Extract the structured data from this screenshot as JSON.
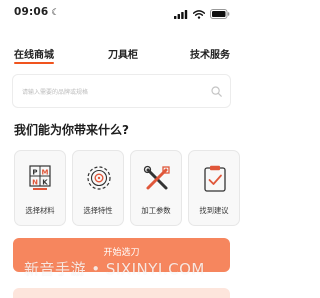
{
  "status_bar": {
    "time": "09:06"
  },
  "tabs": [
    {
      "label": "在线商城",
      "active": true
    },
    {
      "label": "刀具柜",
      "active": false
    },
    {
      "label": "技术服务",
      "active": false
    }
  ],
  "search": {
    "placeholder": "请输入需要的品牌或规格"
  },
  "heading": "我们能为你带来什么?",
  "cards": [
    {
      "label": "选择材料",
      "icon": "material-grid-icon",
      "icon_letters": [
        "P",
        "M",
        "N",
        "K"
      ]
    },
    {
      "label": "选择特性",
      "icon": "gear-icon"
    },
    {
      "label": "加工参数",
      "icon": "tools-icon"
    },
    {
      "label": "找到建议",
      "icon": "clipboard-check-icon"
    }
  ],
  "start_button": "开始选刀",
  "watermark": "新音手游 • SIXINYI.COM",
  "colors": {
    "accent": "#f0541e",
    "button": "#f6865e",
    "icon_accent": "#e0573a"
  }
}
